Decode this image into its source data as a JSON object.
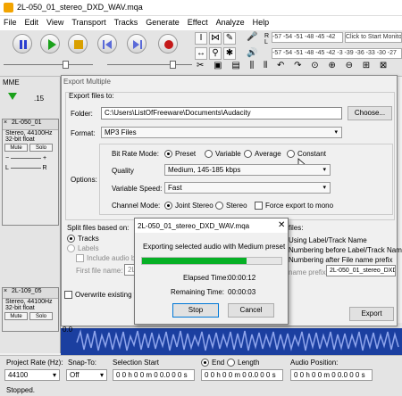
{
  "window": {
    "title": "2L-050_01_stereo_DXD_WAV.mqa"
  },
  "menu": [
    "File",
    "Edit",
    "View",
    "Transport",
    "Tracks",
    "Generate",
    "Effect",
    "Analyze",
    "Help"
  ],
  "toolbar": {
    "meter_top": "-57  -54  -51  -48  -45  -42",
    "monitor_label": "Click to Start Monito",
    "meter_bottom": "-57  -54  -51  -48  -45  -42  -3  -39  -36  -33  -30  -27"
  },
  "left": {
    "host": "MME",
    "scale_value": ".15",
    "tracks": [
      {
        "name": "2L-050_01",
        "info1": "Stereo, 44100Hz",
        "info2": "32-bit float",
        "mute": "Mute",
        "solo": "Solo",
        "l": "L",
        "r": "R"
      },
      {
        "name": "2L-109_05",
        "info1": "Stereo, 44100Hz",
        "info2": "32-bit float",
        "mute": "Mute",
        "solo": "Solo"
      }
    ]
  },
  "export": {
    "title": "Export Multiple",
    "export_files_to": "Export files to:",
    "folder_label": "Folder:",
    "folder_value": "C:\\Users\\ListOfFreeware\\Documents\\Audacity",
    "choose_label": "Choose...",
    "format_label": "Format:",
    "format_value": "MP3 Files",
    "options_label": "Options:",
    "bitrate_label": "Bit Rate Mode:",
    "bitrate_options": [
      "Preset",
      "Variable",
      "Average",
      "Constant"
    ],
    "quality_label": "Quality",
    "quality_value": "Medium, 145-185 kbps",
    "varspeed_label": "Variable Speed:",
    "varspeed_value": "Fast",
    "channel_label": "Channel Mode:",
    "channel_options": [
      "Joint Stereo",
      "Stereo"
    ],
    "force_mono": "Force export to mono",
    "split_label": "Split files based on:",
    "split_tracks": "Tracks",
    "split_labels": "Labels",
    "include_audio": "Include audio b",
    "first_file_name": "First file name:",
    "first_file_value": "2L",
    "name_files_suffix": "files:",
    "name_opt1": "Using Label/Track Name",
    "name_opt2": "Numbering before Label/Track Name",
    "name_opt3": "Numbering after File name prefix",
    "prefix_label": "name prefix:",
    "prefix_value": "2L-050_01_stereo_DXD_WAV",
    "overwrite_label": "Overwrite existing fil",
    "export_button": "Export"
  },
  "progress_dialog": {
    "title": "2L-050_01_stereo_DXD_WAV.mqa",
    "message": "Exporting selected audio with Medium preset",
    "progress": 0.75,
    "elapsed_label": "Elapsed Time:",
    "elapsed_value": "00:00:12",
    "remaining_label": "Remaining Time:",
    "remaining_value": "00:00:03",
    "stop_label": "Stop",
    "cancel_label": "Cancel"
  },
  "status": {
    "project_rate_label": "Project Rate (Hz):",
    "project_rate_value": "44100",
    "snap_label": "Snap-To:",
    "snap_value": "Off",
    "selection_start_label": "Selection Start",
    "selection_start_value": "0 0 h 0 0 m 0 0.0 0 0 s",
    "end_label": "End",
    "length_label": "Length",
    "end_value": "0 0 h 0 0 m 0 0.0 0 0 s",
    "audio_position_label": "Audio Position:",
    "audio_position_value": "0 0 h 0 0 m 0 0.0 0 0 s",
    "state": "Stopped.",
    "ruler_value": "0.0"
  }
}
